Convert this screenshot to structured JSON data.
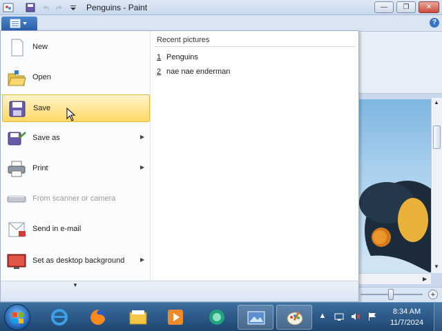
{
  "window": {
    "title": "Penguins - Paint"
  },
  "title_buttons": {
    "minimize": "—",
    "maximize": "❐",
    "close": "✕"
  },
  "help": "?",
  "app_menu": {
    "items": [
      {
        "label": "New",
        "icon": "new-document-icon",
        "has_submenu": false,
        "enabled": true
      },
      {
        "label": "Open",
        "icon": "open-folder-icon",
        "has_submenu": false,
        "enabled": true
      },
      {
        "label": "Save",
        "icon": "save-disk-icon",
        "has_submenu": false,
        "enabled": true,
        "highlighted": true
      },
      {
        "label": "Save as",
        "icon": "save-as-icon",
        "has_submenu": true,
        "enabled": true
      },
      {
        "label": "Print",
        "icon": "printer-icon",
        "has_submenu": true,
        "enabled": true
      },
      {
        "label": "From scanner or camera",
        "icon": "scanner-icon",
        "has_submenu": false,
        "enabled": false
      },
      {
        "label": "Send in e-mail",
        "icon": "email-icon",
        "has_submenu": false,
        "enabled": true
      },
      {
        "label": "Set as desktop background",
        "icon": "desktop-background-icon",
        "has_submenu": true,
        "enabled": true
      }
    ],
    "recent": {
      "header": "Recent pictures",
      "items": [
        {
          "num": "1",
          "name": "Penguins"
        },
        {
          "num": "2",
          "name": "nae nae enderman"
        }
      ]
    },
    "more_arrow": "▼"
  },
  "status": {
    "zoom_plus": "+"
  },
  "taskbar": {
    "apps": [
      {
        "name": "internet-explorer-icon",
        "active": false
      },
      {
        "name": "firefox-icon",
        "active": false
      },
      {
        "name": "file-explorer-icon",
        "active": false
      },
      {
        "name": "media-player-icon",
        "active": false
      },
      {
        "name": "green-app-icon",
        "active": false
      },
      {
        "name": "photo-viewer-icon",
        "active": true
      },
      {
        "name": "paint-icon",
        "active": true
      }
    ],
    "clock": {
      "time": "8:34 AM",
      "date": "11/7/2024"
    }
  },
  "colors": {
    "highlight": "#ffd966",
    "accent": "#2a5fa8"
  }
}
